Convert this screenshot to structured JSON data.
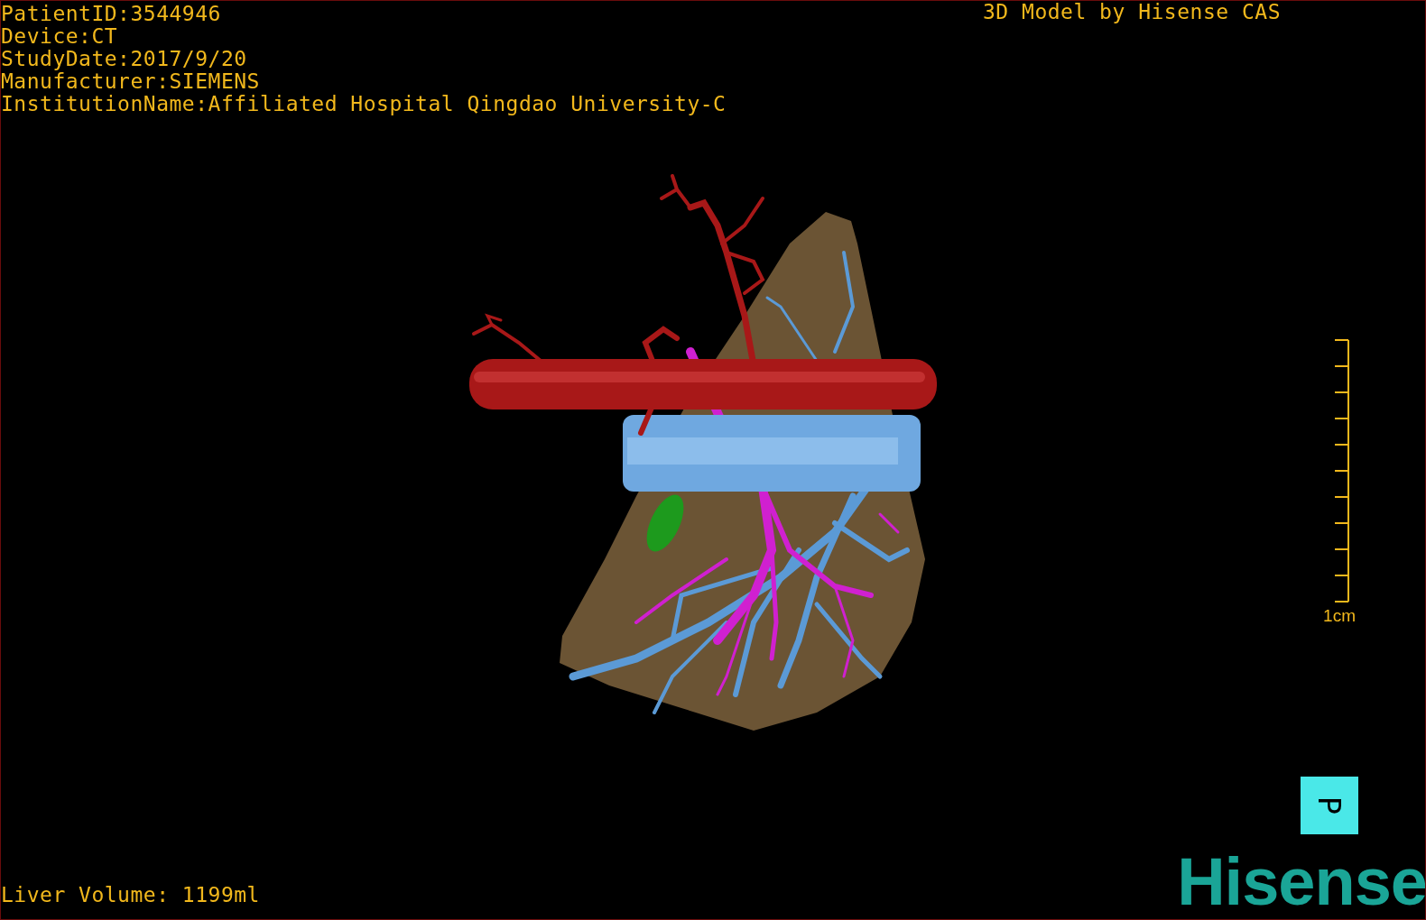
{
  "patient_info": [
    "PatientID:3544946",
    "Device:CT",
    "StudyDate:2017/9/20",
    "Manufacturer:SIEMENS",
    "InstitutionName:Affiliated Hospital Qingdao University-C"
  ],
  "credit": "3D Model by Hisense CAS",
  "scale": {
    "label": "1cm"
  },
  "volume": "Liver Volume: 1199ml",
  "orientation_cube": {
    "label": "P"
  },
  "logo": "Hisense"
}
